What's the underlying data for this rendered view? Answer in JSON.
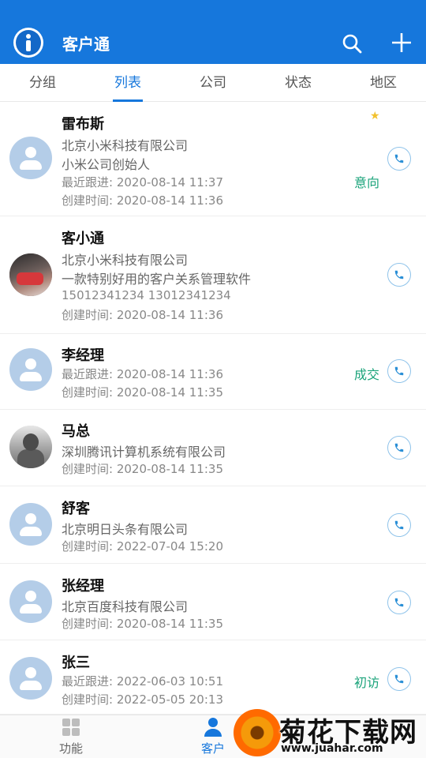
{
  "app": {
    "title": "客户通"
  },
  "tabs": [
    {
      "label": "分组"
    },
    {
      "label": "列表"
    },
    {
      "label": "公司"
    },
    {
      "label": "状态"
    },
    {
      "label": "地区"
    }
  ],
  "customers": [
    {
      "name": "雷布斯",
      "line1": "北京小米科技有限公司",
      "line2": "小米公司创始人",
      "line3": "最近跟进: 2020-08-14 11:37",
      "line4": "创建时间: 2020-08-14 11:36",
      "status": "意向",
      "starred": true
    },
    {
      "name": "客小通",
      "line1": "北京小米科技有限公司",
      "line2": "一款特别好用的客户关系管理软件",
      "line3": "15012341234 13012341234",
      "line4": "创建时间: 2020-08-14 11:36",
      "status": ""
    },
    {
      "name": "李经理",
      "line1": "最近跟进: 2020-08-14 11:36",
      "line2": "创建时间: 2020-08-14 11:35",
      "status": "成交"
    },
    {
      "name": "马总",
      "line1": "深圳腾讯计算机系统有限公司",
      "line2": "创建时间: 2020-08-14 11:35",
      "status": ""
    },
    {
      "name": "舒客",
      "line1": "北京明日头条有限公司",
      "line2": "创建时间: 2022-07-04 15:20",
      "status": ""
    },
    {
      "name": "张经理",
      "line1": "北京百度科技有限公司",
      "line2": "创建时间: 2020-08-14 11:35",
      "status": ""
    },
    {
      "name": "张三",
      "line1": "最近跟进: 2022-06-03 10:51",
      "line2": "创建时间: 2022-05-05 20:13",
      "status": "初访"
    }
  ],
  "bottom_nav": [
    {
      "label": "功能"
    },
    {
      "label": "客户"
    }
  ],
  "watermark": {
    "text": "菊花下载网",
    "url": "www.juahar.com"
  },
  "colors": {
    "brand": "#1677dc",
    "status": "#1aa37a",
    "star": "#f2c12e"
  }
}
